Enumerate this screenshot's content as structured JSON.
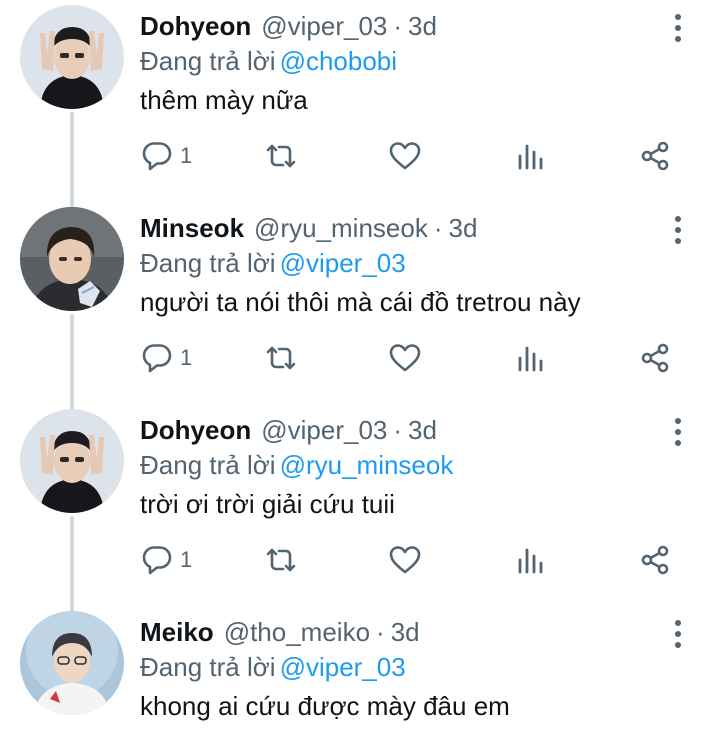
{
  "tweets": [
    {
      "name": "Dohyeon",
      "handle": "@viper_03",
      "separator": "·",
      "time": "3d",
      "reply_prefix": "Đang trả lời",
      "reply_mention": "@chobobi",
      "text": "thêm mày nữa",
      "reply_count": "1",
      "avatar": "avatar-peace-sign"
    },
    {
      "name": "Minseok",
      "handle": "@ryu_minseok",
      "separator": "·",
      "time": "3d",
      "reply_prefix": "Đang trả lời",
      "reply_mention": "@viper_03",
      "text": "người ta nói thôi mà cái đồ tretrou này",
      "reply_count": "1",
      "avatar": "avatar-portrait"
    },
    {
      "name": "Dohyeon",
      "handle": "@viper_03",
      "separator": "·",
      "time": "3d",
      "reply_prefix": "Đang trả lời",
      "reply_mention": "@ryu_minseok",
      "text": "trời ơi trời giải cứu tuii",
      "reply_count": "1",
      "avatar": "avatar-peace-sign"
    },
    {
      "name": "Meiko",
      "handle": "@tho_meiko",
      "separator": "·",
      "time": "3d",
      "reply_prefix": "Đang trả lời",
      "reply_mention": "@viper_03",
      "text": "khong ai cứu được mày đâu em",
      "avatar": "avatar-portrait"
    }
  ],
  "icons": [
    "reply-icon",
    "retweet-icon",
    "like-icon",
    "views-icon",
    "share-icon",
    "more-icon"
  ],
  "colors": {
    "mention": "#1d9bf0",
    "secondary_text": "#536471",
    "thread_line": "#cfd9de"
  }
}
